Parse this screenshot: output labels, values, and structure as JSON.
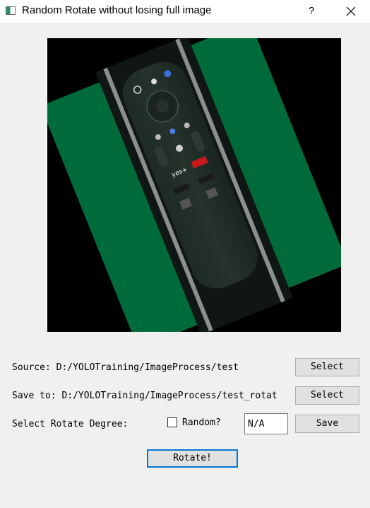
{
  "window": {
    "title": "Random Rotate without losing full image",
    "help_label": "?"
  },
  "colors": {
    "background": "#f0f0f0",
    "preview_background": "#000000",
    "green_region": "#006b3a",
    "default_button_border": "#0078d7"
  },
  "preview": {
    "description_icon": "rotated-image-preview",
    "remote_brand_text": "yes+"
  },
  "source": {
    "label": "Source: D:/YOLOTraining/ImageProcess/test",
    "button_label": "Select"
  },
  "save_to": {
    "label": "Save to: D:/YOLOTraining/ImageProcess/test_rotat",
    "button_label": "Select"
  },
  "rotate_degree": {
    "label": "Select Rotate Degree:",
    "random_label": "Random?",
    "random_checked": false,
    "value": "N/A",
    "save_button_label": "Save"
  },
  "rotate_button_label": "Rotate!"
}
